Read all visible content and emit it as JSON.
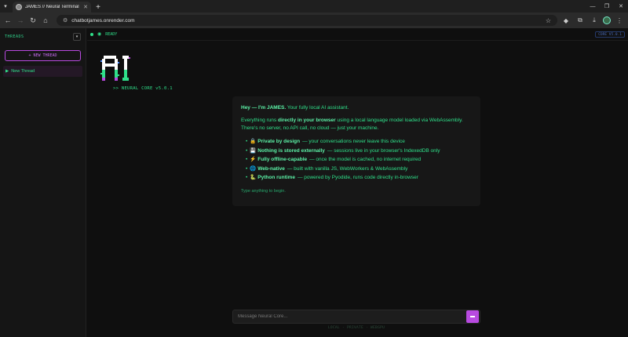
{
  "browser": {
    "tab_title": "JAMES // Neural Terminal",
    "url": "chatbotjames.onrender.com",
    "new_tab_symbol": "+"
  },
  "sidebar": {
    "title": "THREADS",
    "new_thread_label": "+ NEW THREAD",
    "threads": [
      {
        "label": "New Thread",
        "active": true
      }
    ]
  },
  "status": {
    "text": "READY",
    "version_badge": "CORE V5.0.1"
  },
  "logo": {
    "caption": ">> NEURAL CORE v5.0.1"
  },
  "welcome": {
    "greeting_bold": "Hey — I'm JAMES.",
    "greeting_rest": " Your fully local AI assistant.",
    "intro_pre": "Everything runs ",
    "intro_bold": "directly in your browser",
    "intro_post": " using a local language model loaded via WebAssembly. There's no server, no API call, no cloud — just your machine.",
    "features": [
      {
        "icon": "lock-icon",
        "glyph": "🔒",
        "title": "Private by design",
        "desc": " — your conversations never leave this device"
      },
      {
        "icon": "disk-icon",
        "glyph": "💾",
        "title": "Nothing is stored externally",
        "desc": " — sessions live in your browser's IndexedDB only"
      },
      {
        "icon": "lightning-icon",
        "glyph": "⚡",
        "title": "Fully offline-capable",
        "desc": " — once the model is cached, no internet required"
      },
      {
        "icon": "globe-icon",
        "glyph": "🌐",
        "title": "Web-native",
        "desc": " — built with vanilla JS, WebWorkers & WebAssembly"
      },
      {
        "icon": "python-icon",
        "glyph": "🐍",
        "title": "Python runtime",
        "desc": " — powered by Pyodide, runs code directly in-browser"
      }
    ],
    "hint": "Type anything to begin."
  },
  "composer": {
    "placeholder": "Message Neural Core..."
  },
  "footer": {
    "text": "LOCAL · PRIVATE · WEBGPU"
  },
  "colors": {
    "accent_green": "#2fe08a",
    "accent_purple": "#b84ae0",
    "background": "#0f0f0f"
  }
}
